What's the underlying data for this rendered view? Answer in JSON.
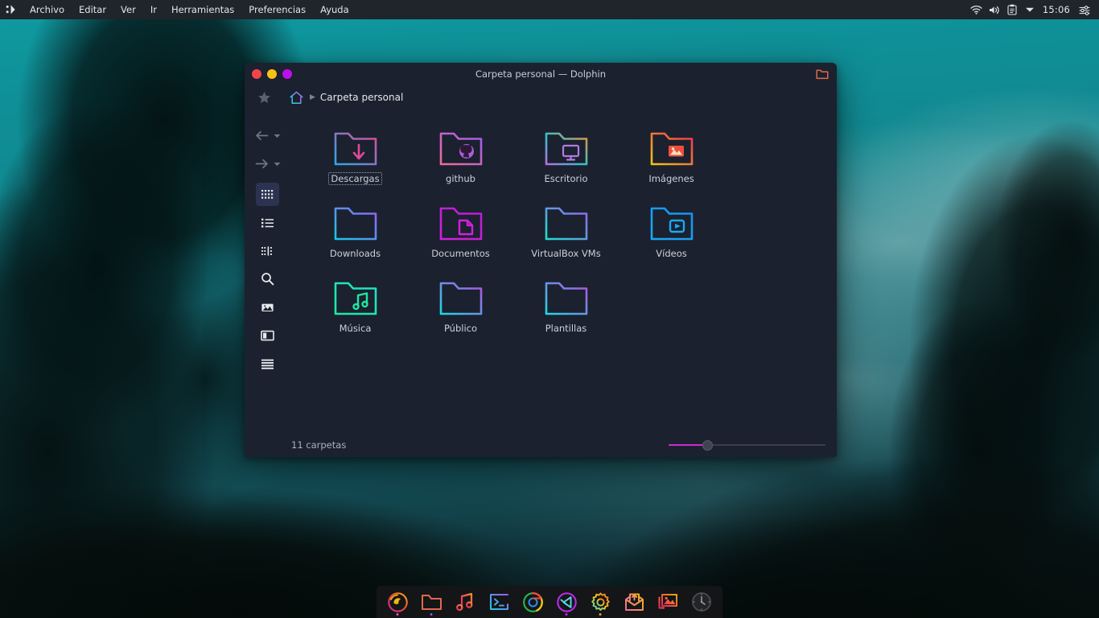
{
  "panel": {
    "logo_icon": "smiley-logo-icon",
    "menus": [
      {
        "label": "Archivo"
      },
      {
        "label": "Editar"
      },
      {
        "label": "Ver"
      },
      {
        "label": "Ir"
      },
      {
        "label": "Herramientas"
      },
      {
        "label": "Preferencias"
      },
      {
        "label": "Ayuda"
      }
    ],
    "tray": {
      "icons": [
        "wifi-icon",
        "volume-icon",
        "clipboard-icon",
        "chevron-down-icon"
      ],
      "clock": "15:06",
      "settings_icon": "sliders-icon"
    }
  },
  "window": {
    "title": "Carpeta personal — Dolphin",
    "buttons": {
      "close_color": "#f2454b",
      "minimize_color": "#f5c316",
      "maximize_color": "#bb10ea"
    },
    "title_folder_icon": "folder-icon",
    "breadcrumb": {
      "star_icon": "star-icon",
      "home_icon": "home-icon",
      "separator": "▶",
      "label": "Carpeta personal"
    },
    "toolbar": [
      {
        "name": "back-button",
        "icon": "arrow-left-icon",
        "caret": true,
        "selected": false
      },
      {
        "name": "forward-button",
        "icon": "arrow-right-icon",
        "caret": true,
        "selected": false
      },
      {
        "name": "icons-view-button",
        "icon": "grid-icon",
        "selected": true
      },
      {
        "name": "details-view-button",
        "icon": "list-icon",
        "selected": false
      },
      {
        "name": "compact-view-button",
        "icon": "columns-icon",
        "selected": false
      },
      {
        "name": "search-button",
        "icon": "search-icon",
        "selected": false
      },
      {
        "name": "preview-button",
        "icon": "image-icon",
        "selected": false
      },
      {
        "name": "split-view-button",
        "icon": "split-icon",
        "selected": false
      },
      {
        "name": "menu-button",
        "icon": "hamburger-icon",
        "selected": false
      }
    ],
    "files": [
      {
        "label": "Descargas",
        "icon": "folder-download-icon",
        "c1": "#2aa8e8",
        "c2": "#e0499a",
        "selected": true
      },
      {
        "label": "github",
        "icon": "folder-github-icon",
        "c1": "#f06c9b",
        "c2": "#9b5cf0",
        "selected": false
      },
      {
        "label": "Escritorio",
        "icon": "folder-desktop-icon",
        "c1": "#f0913c",
        "c2": "#2fd0d8",
        "selected": false
      },
      {
        "label": "Imágenes",
        "icon": "folder-image-icon",
        "c1": "#f5c518",
        "c2": "#ef2f52",
        "selected": false
      },
      {
        "label": "Downloads",
        "icon": "folder-plain-icon",
        "c1": "#17c8e8",
        "c2": "#9b5cf0",
        "selected": false
      },
      {
        "label": "Documentos",
        "icon": "folder-document-icon",
        "c1": "#d41fe0",
        "c2": "#c31fd0",
        "selected": false
      },
      {
        "label": "VirtualBox VMs",
        "icon": "folder-plain-icon",
        "c1": "#1fe0cf",
        "c2": "#9b5cf0",
        "selected": false
      },
      {
        "label": "Vídeos",
        "icon": "folder-video-icon",
        "c1": "#1aa8f5",
        "c2": "#1792ef",
        "selected": false
      },
      {
        "label": "Música",
        "icon": "folder-music-icon",
        "c1": "#1fe8a0",
        "c2": "#1fe0b8",
        "selected": false
      },
      {
        "label": "Público",
        "icon": "folder-plain-icon",
        "c1": "#1fd8e8",
        "c2": "#b34fe0",
        "selected": false
      },
      {
        "label": "Plantillas",
        "icon": "folder-plain-icon",
        "c1": "#1fd8e8",
        "c2": "#b34fe0",
        "selected": false
      }
    ],
    "status": {
      "text": "11 carpetas",
      "zoom_fill_color": "#cd2ad6"
    }
  },
  "dock": {
    "items": [
      {
        "name": "firefox",
        "icon": "firefox-icon",
        "running": true
      },
      {
        "name": "file-manager",
        "icon": "folder-icon",
        "running": true
      },
      {
        "name": "music-player",
        "icon": "music-note-icon",
        "running": false
      },
      {
        "name": "terminal",
        "icon": "terminal-icon",
        "running": false
      },
      {
        "name": "chrome",
        "icon": "chrome-icon",
        "running": false
      },
      {
        "name": "vscode",
        "icon": "vscode-icon",
        "running": true
      },
      {
        "name": "settings",
        "icon": "gear-icon",
        "running": true
      },
      {
        "name": "mail",
        "icon": "mail-upload-icon",
        "running": false
      },
      {
        "name": "image-viewer",
        "icon": "image-icon",
        "running": false
      },
      {
        "name": "clock",
        "icon": "clock-icon",
        "running": false
      }
    ]
  }
}
